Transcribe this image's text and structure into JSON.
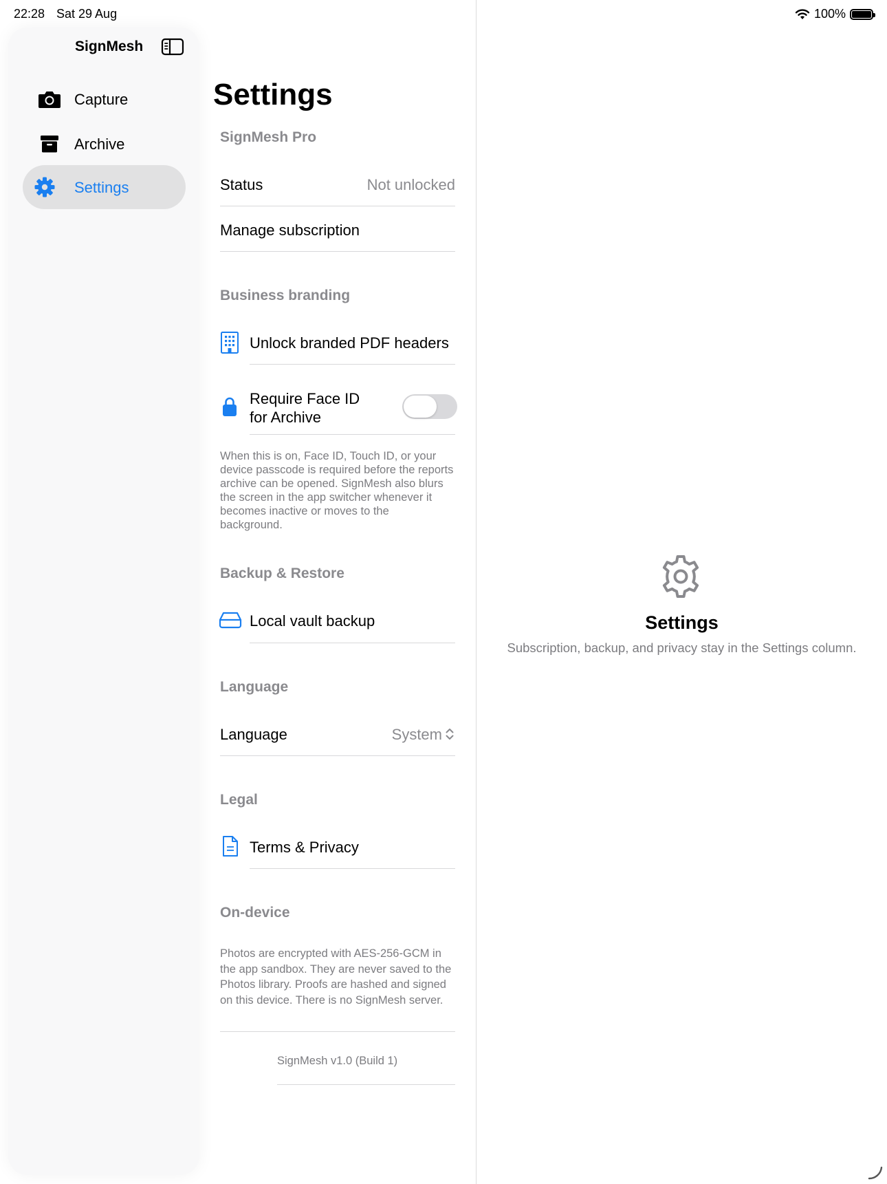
{
  "status_bar": {
    "time": "22:28",
    "date": "Sat 29 Aug",
    "battery": "100%"
  },
  "sidebar": {
    "title": "SignMesh",
    "items": [
      {
        "label": "Capture",
        "icon": "camera-icon",
        "selected": false
      },
      {
        "label": "Archive",
        "icon": "archive-box-icon",
        "selected": false
      },
      {
        "label": "Settings",
        "icon": "gear-icon",
        "selected": true
      }
    ]
  },
  "settings": {
    "title": "Settings",
    "pro": {
      "header": "SignMesh Pro",
      "status_label": "Status",
      "status_value": "Not unlocked",
      "manage_label": "Manage subscription"
    },
    "branding": {
      "header": "Business branding",
      "unlock_label": "Unlock branded PDF headers",
      "faceid_line1": "Require Face ID",
      "faceid_line2": "for Archive",
      "faceid_on": false,
      "footnote": "When this is on, Face ID, Touch ID, or your device passcode is required before the reports archive can be opened. SignMesh also blurs the screen in the app switcher whenever it becomes inactive or moves to the background."
    },
    "backup": {
      "header": "Backup & Restore",
      "local_label": "Local vault backup"
    },
    "language": {
      "header": "Language",
      "label": "Language",
      "value": "System"
    },
    "legal": {
      "header": "Legal",
      "terms_label": "Terms & Privacy"
    },
    "ondevice": {
      "header": "On-device",
      "text": "Photos are encrypted with AES-256-GCM in the app sandbox. They are never saved to the Photos library. Proofs are hashed and signed on this device. There is no SignMesh server."
    },
    "version": "SignMesh v1.0 (Build 1)"
  },
  "detail": {
    "title": "Settings",
    "subtitle": "Subscription, backup, and privacy stay in the Settings column."
  },
  "colors": {
    "accent": "#1a7ff0",
    "secondary_text": "#8a8a8e",
    "selected_bg": "#e1e1e2"
  }
}
